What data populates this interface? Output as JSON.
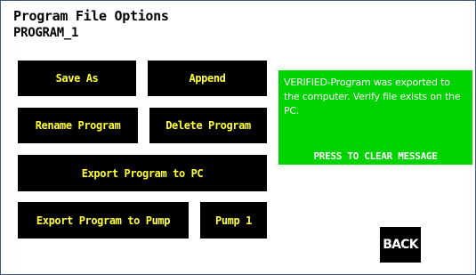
{
  "header": {
    "title": "Program File Options",
    "program_name": "PROGRAM_1"
  },
  "buttons": {
    "save_as": "Save As",
    "append": "Append",
    "rename_program": "Rename Program",
    "delete_program": "Delete Program",
    "export_to_pc": "Export Program to PC",
    "export_to_pump": "Export Program to Pump",
    "pump_select": "Pump 1",
    "back": "BACK"
  },
  "message": {
    "text": "VERIFIED-Program was exported to the computer. Verify file exists on the PC.",
    "action": "PRESS TO CLEAR MESSAGE"
  },
  "colors": {
    "button_background": "#000000",
    "button_text": "#ffff33",
    "message_background": "#00d400",
    "message_text": "#ffffff",
    "back_text": "#ffffff"
  }
}
